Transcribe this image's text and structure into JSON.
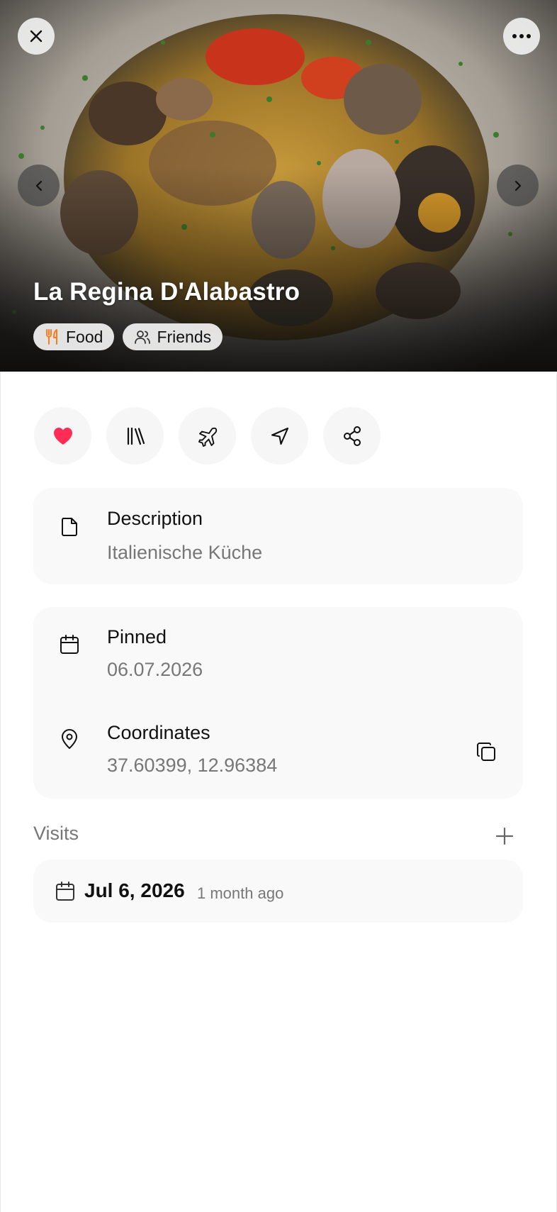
{
  "place": {
    "title": "La Regina D'Alabastro",
    "tags": [
      {
        "label": "Food",
        "icon": "fork-knife-icon",
        "color": "#ff7a1a"
      },
      {
        "label": "Friends",
        "icon": "users-icon",
        "color": "#333333"
      }
    ]
  },
  "header": {
    "close_icon": "close-icon",
    "more_icon": "more-horizontal-icon",
    "prev_icon": "chevron-left-icon",
    "next_icon": "chevron-right-icon"
  },
  "actions": [
    {
      "name": "favorite",
      "icon": "heart-icon",
      "color": "#ff2d55"
    },
    {
      "name": "collections",
      "icon": "library-icon"
    },
    {
      "name": "trip",
      "icon": "plane-icon"
    },
    {
      "name": "navigate",
      "icon": "navigation-arrow-icon"
    },
    {
      "name": "share",
      "icon": "share-icon"
    }
  ],
  "description": {
    "label": "Description",
    "value": "Italienische Küche"
  },
  "pinned": {
    "label": "Pinned",
    "value": "06.07.2026"
  },
  "coordinates": {
    "label": "Coordinates",
    "value": "37.60399, 12.96384"
  },
  "visits": {
    "heading": "Visits",
    "items": [
      {
        "date": "Jul 6, 2026",
        "relative": "1 month ago"
      }
    ]
  }
}
